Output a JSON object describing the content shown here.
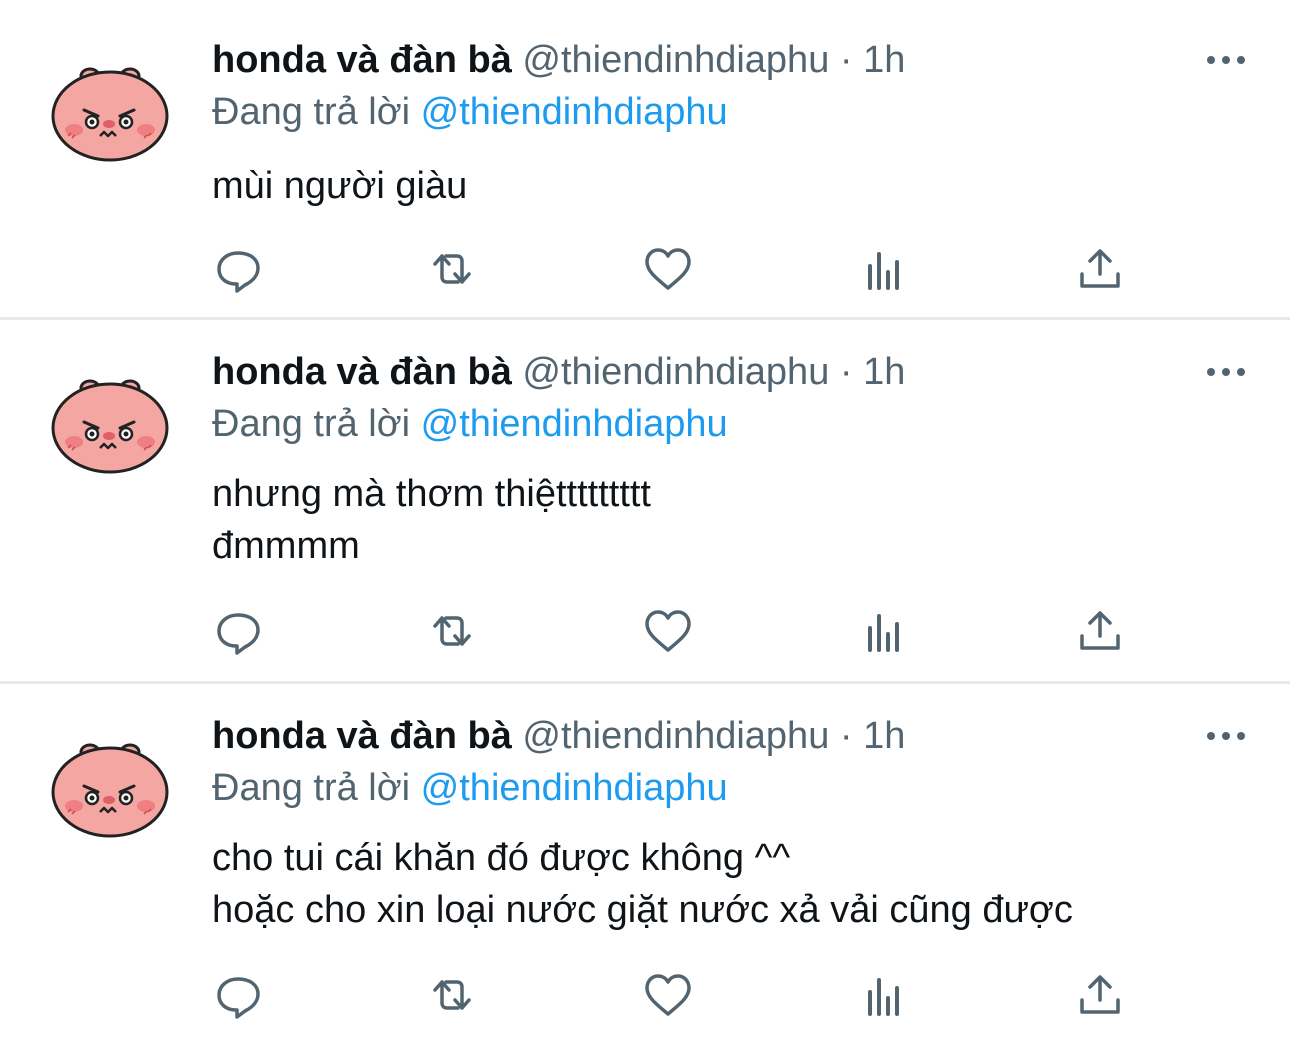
{
  "colors": {
    "text": "#0f1419",
    "secondary": "#536471",
    "link": "#1d9bf0",
    "divider": "#e7e9ea",
    "icon": "#536471",
    "avatar_face": "#f4a6a3"
  },
  "tweets": [
    {
      "name": "honda và đàn bà",
      "handle": "@thiendinhdiaphu",
      "dot": "·",
      "time": "1h",
      "reply_prefix": "Đang trả lời",
      "reply_handle": "@thiendinhdiaphu",
      "lines": [
        "mùi người giàu"
      ]
    },
    {
      "name": "honda và đàn bà",
      "handle": "@thiendinhdiaphu",
      "dot": "·",
      "time": "1h",
      "reply_prefix": "Đang trả lời",
      "reply_handle": "@thiendinhdiaphu",
      "lines": [
        "nhưng mà thơm thiệttttttttt",
        "đmmmm"
      ]
    },
    {
      "name": "honda và đàn bà",
      "handle": "@thiendinhdiaphu",
      "dot": "·",
      "time": "1h",
      "reply_prefix": "Đang trả lời",
      "reply_handle": "@thiendinhdiaphu",
      "lines": [
        "cho tui cái khăn đó được không ^^",
        "hoặc cho xin loại nước giặt nước xả vải cũng được"
      ]
    }
  ],
  "icons": {
    "avatar": "pink-bear-avatar",
    "more": "more-horizontal-icon",
    "reply": "reply-icon",
    "retweet": "retweet-icon",
    "like": "heart-icon",
    "stats": "analytics-icon",
    "share": "share-icon"
  }
}
